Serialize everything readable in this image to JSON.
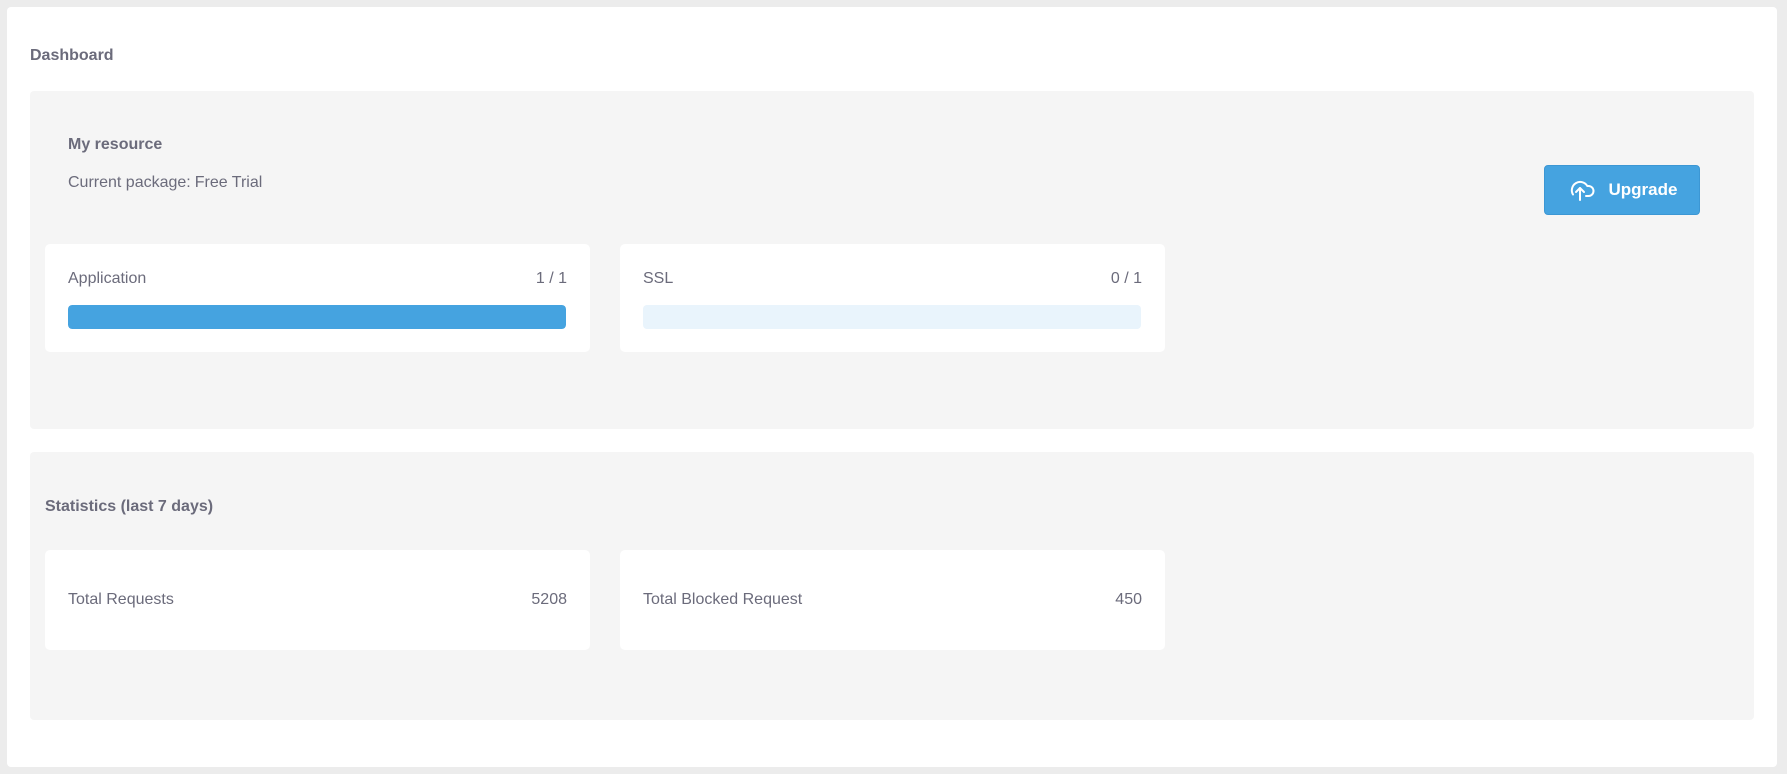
{
  "page": {
    "title": "Dashboard"
  },
  "resource": {
    "heading": "My resource",
    "package_label": "Current package:",
    "package_value": "Free Trial",
    "upgrade_label": "Upgrade",
    "upgrade_icon": "cloud-upload-icon",
    "usage": [
      {
        "label": "Application",
        "value": "1 / 1",
        "used": 1,
        "limit": 1
      },
      {
        "label": "SSL",
        "value": "0 / 1",
        "used": 0,
        "limit": 1
      }
    ]
  },
  "statistics": {
    "heading": "Statistics (last 7 days)",
    "items": [
      {
        "label": "Total Requests",
        "value": "5208"
      },
      {
        "label": "Total Blocked Request",
        "value": "450"
      }
    ]
  },
  "colors": {
    "accent": "#45a3e0",
    "track": "#e9f4fc",
    "panel": "#f5f5f5",
    "text": "#6b6b7b"
  }
}
